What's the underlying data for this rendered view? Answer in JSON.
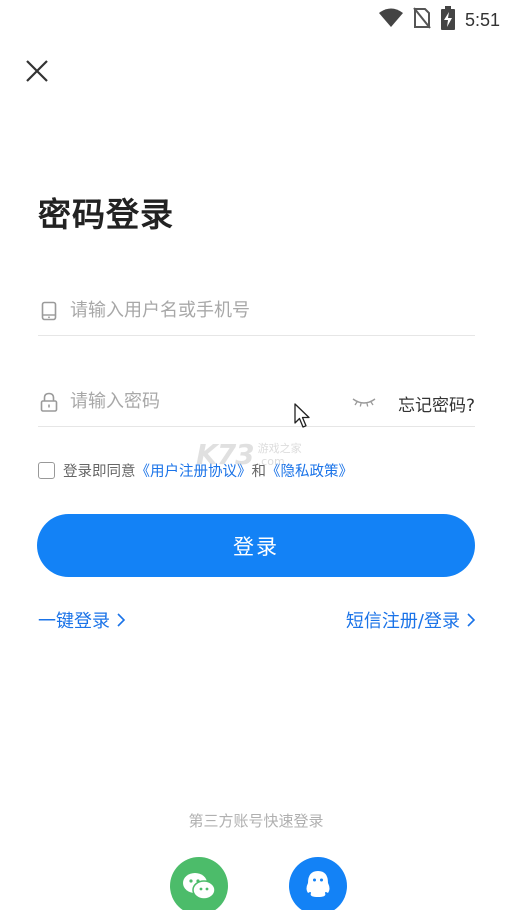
{
  "status_bar": {
    "time": "5:51",
    "icons": [
      "wifi-icon",
      "no-sim-icon",
      "battery-charging-icon"
    ]
  },
  "close": {
    "icon": "close-icon"
  },
  "title": "密码登录",
  "username": {
    "placeholder": "请输入用户名或手机号",
    "value": "",
    "icon": "phone-icon"
  },
  "password": {
    "placeholder": "请输入密码",
    "value": "",
    "icon": "lock-icon",
    "visibility_icon": "eye-closed-icon",
    "forgot_label": "忘记密码?"
  },
  "agreement": {
    "prefix": "登录即同意",
    "user_agreement": "《用户注册协议》",
    "conjunction": "和",
    "privacy_policy": "《隐私政策》",
    "checked": false
  },
  "login_button": "登录",
  "links": {
    "one_click": "一键登录",
    "sms": "短信注册/登录"
  },
  "third_party": {
    "title": "第三方账号快速登录",
    "providers": [
      "wechat-icon",
      "qq-icon"
    ]
  },
  "watermark": {
    "logo": "K73",
    "line1": "游戏之家",
    "line2": ".com"
  },
  "colors": {
    "primary": "#1382f6",
    "link": "#1a73e8",
    "wechat": "#4cbc6a"
  }
}
